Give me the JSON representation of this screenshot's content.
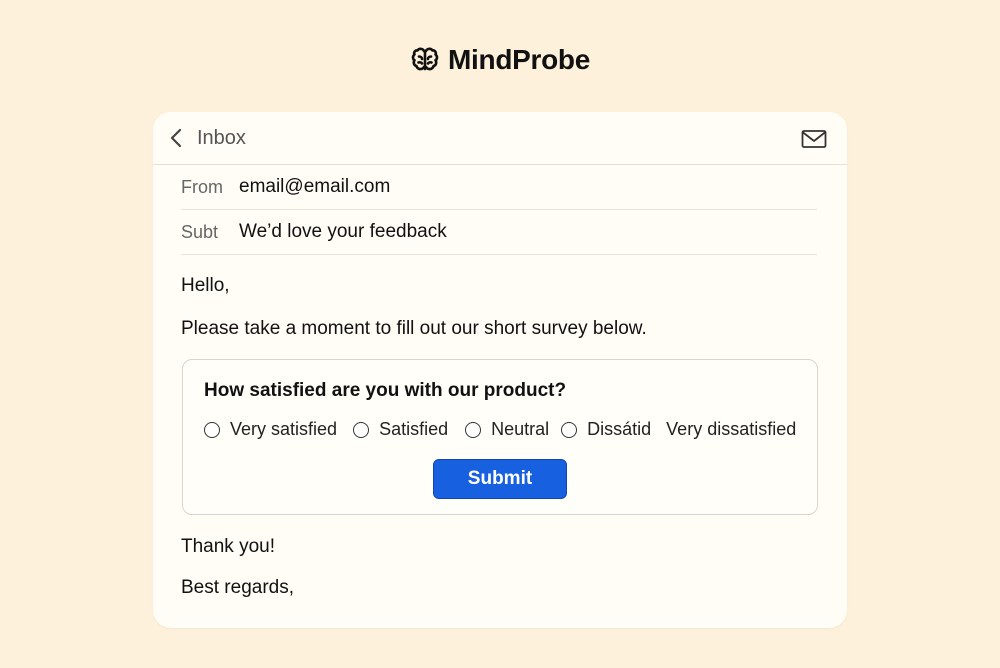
{
  "brand": {
    "name": "MindProbe",
    "icon": "brain-icon"
  },
  "header": {
    "back_label": "Inbox",
    "back_icon": "chevron-left-icon",
    "mail_icon": "envelope-icon"
  },
  "email": {
    "from_label": "From",
    "from_value": "email@email.com",
    "subject_label": "Subt",
    "subject_value": "We’d love your feedback",
    "greeting": "Hello,",
    "intro": "Please take a moment to fill out our short survey below.",
    "closing": "Thank you!",
    "signoff": "Best regards,"
  },
  "survey": {
    "question": "How satisfied are you with our product?",
    "options": [
      {
        "label": "Very satisfied",
        "has_radio": true
      },
      {
        "label": "Satisfied",
        "has_radio": true
      },
      {
        "label": "Neutral",
        "has_radio": true
      },
      {
        "label": "Dissátid",
        "has_radio": true
      },
      {
        "label": "Very dissatisfied",
        "has_radio": false
      }
    ],
    "submit_label": "Submit"
  },
  "colors": {
    "page_background": "#fdf1dc",
    "card_background": "#fffdf6",
    "submit_button": "#1760e0"
  }
}
